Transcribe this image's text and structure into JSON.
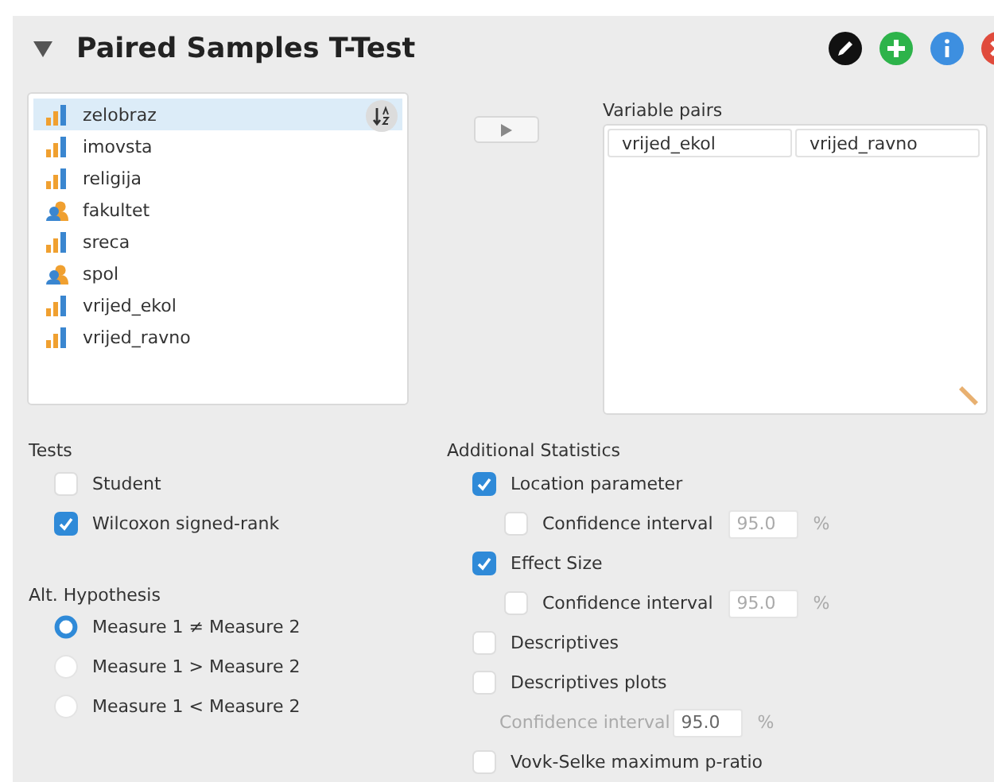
{
  "panel": {
    "title": "Paired Samples T-Test",
    "expanded": true
  },
  "variables": [
    {
      "name": "zelobraz",
      "kind": "scale",
      "selected": true
    },
    {
      "name": "imovsta",
      "kind": "scale",
      "selected": false
    },
    {
      "name": "religija",
      "kind": "scale",
      "selected": false
    },
    {
      "name": "fakultet",
      "kind": "nominal",
      "selected": false
    },
    {
      "name": "sreca",
      "kind": "scale",
      "selected": false
    },
    {
      "name": "spol",
      "kind": "nominal",
      "selected": false
    },
    {
      "name": "vrijed_ekol",
      "kind": "scale",
      "selected": false
    },
    {
      "name": "vrijed_ravno",
      "kind": "scale",
      "selected": false
    }
  ],
  "variable_pairs": {
    "label": "Variable pairs",
    "pairs": [
      [
        "vrijed_ekol",
        "vrijed_ravno"
      ]
    ]
  },
  "tests": {
    "label": "Tests",
    "options": [
      {
        "label": "Student",
        "checked": false
      },
      {
        "label": "Wilcoxon signed-rank",
        "checked": true
      }
    ]
  },
  "alt_hypothesis": {
    "label": "Alt. Hypothesis",
    "options": [
      {
        "label": "Measure 1 ≠ Measure 2",
        "selected": true
      },
      {
        "label": "Measure 1 > Measure 2",
        "selected": false
      },
      {
        "label": "Measure 1 < Measure 2",
        "selected": false
      }
    ]
  },
  "additional_statistics": {
    "label": "Additional Statistics",
    "options": [
      {
        "kind": "checkbox",
        "label": "Location parameter",
        "checked": true,
        "children": [
          {
            "kind": "checkbox-field",
            "label": "Confidence interval",
            "checked": false,
            "value": "95.0",
            "unit": "%",
            "disabled": false
          }
        ]
      },
      {
        "kind": "checkbox",
        "label": "Effect Size",
        "checked": true,
        "children": [
          {
            "kind": "checkbox-field",
            "label": "Confidence interval",
            "checked": false,
            "value": "95.0",
            "unit": "%",
            "disabled": false
          }
        ]
      },
      {
        "kind": "checkbox",
        "label": "Descriptives",
        "checked": false
      },
      {
        "kind": "checkbox",
        "label": "Descriptives plots",
        "checked": false,
        "children": [
          {
            "kind": "field",
            "label": "Confidence interval",
            "value": "95.0",
            "unit": "%",
            "disabled": true
          }
        ]
      },
      {
        "kind": "checkbox",
        "label": "Vovk-Selke maximum p-ratio",
        "checked": false
      }
    ]
  }
}
